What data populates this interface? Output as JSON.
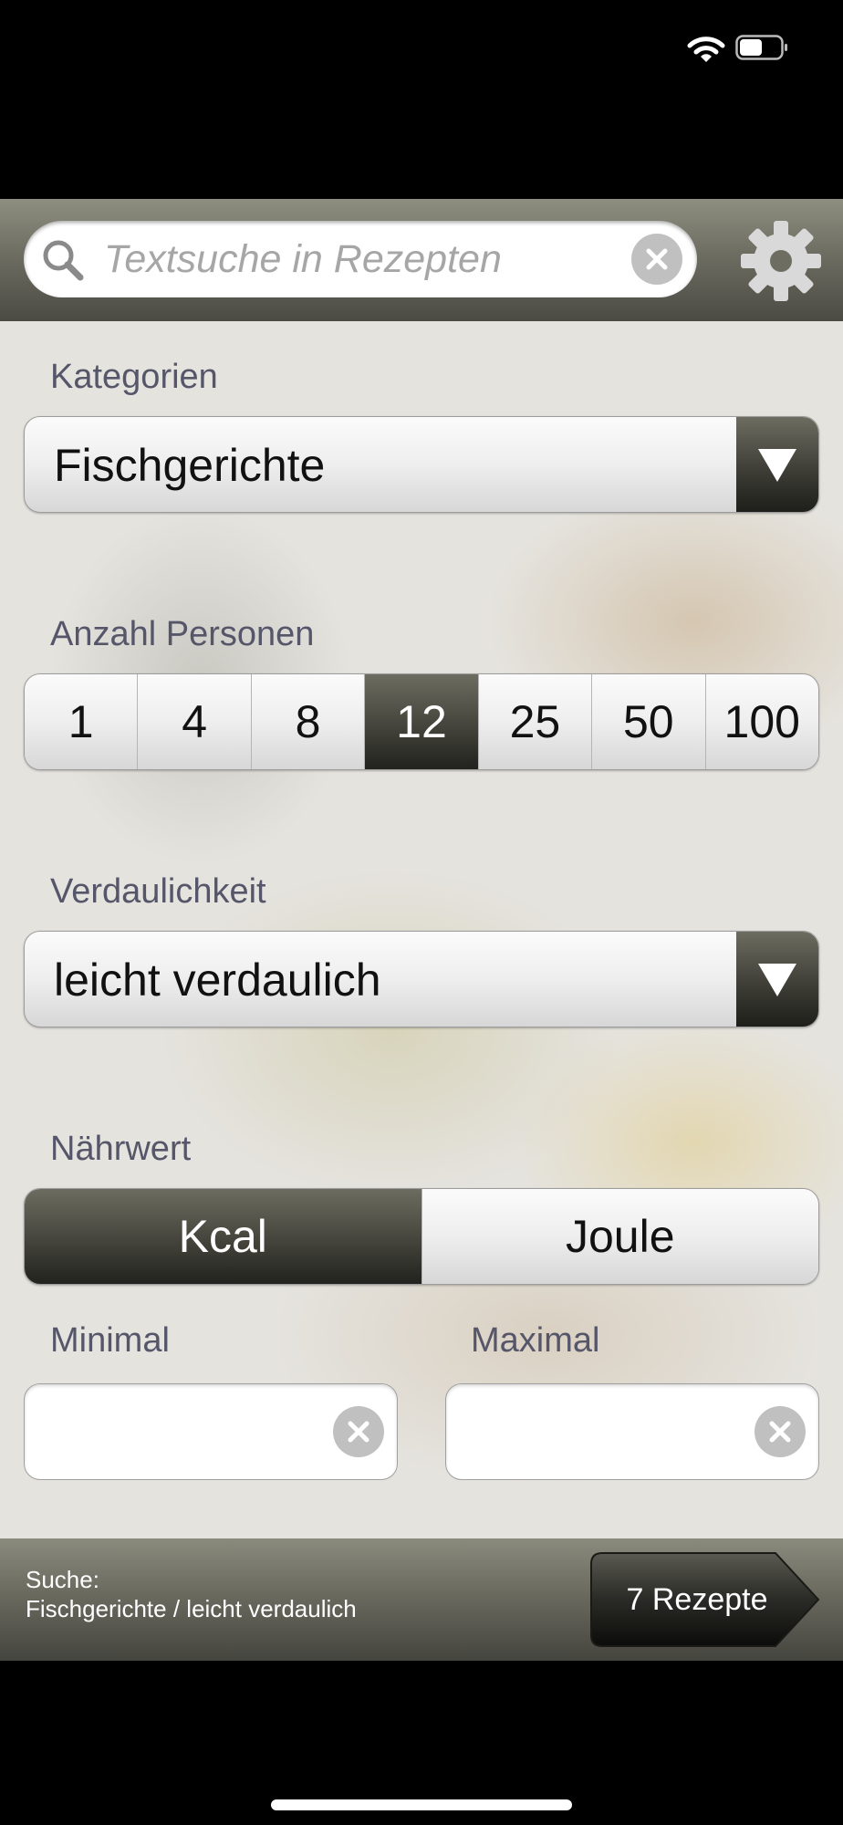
{
  "header": {
    "search_placeholder": "Textsuche in Rezepten",
    "search_value": ""
  },
  "kategorien": {
    "label": "Kategorien",
    "selected": "Fischgerichte"
  },
  "personen": {
    "label": "Anzahl Personen",
    "options": [
      "1",
      "4",
      "8",
      "12",
      "25",
      "50",
      "100"
    ],
    "selected": "12"
  },
  "verdaulichkeit": {
    "label": "Verdaulichkeit",
    "selected": "leicht verdaulich"
  },
  "naehrwert": {
    "label": "Nährwert",
    "options": [
      "Kcal",
      "Joule"
    ],
    "selected": "Kcal"
  },
  "range": {
    "min_label": "Minimal",
    "min_value": "",
    "max_label": "Maximal",
    "max_value": ""
  },
  "footer": {
    "summary_label": "Suche:",
    "summary_value": "Fischgerichte / leicht verdaulich",
    "results_button": "7 Rezepte"
  },
  "colors": {
    "accent_dark": "#3e3e37",
    "header_bar": "#6d6d62",
    "label_text": "#56566a"
  }
}
